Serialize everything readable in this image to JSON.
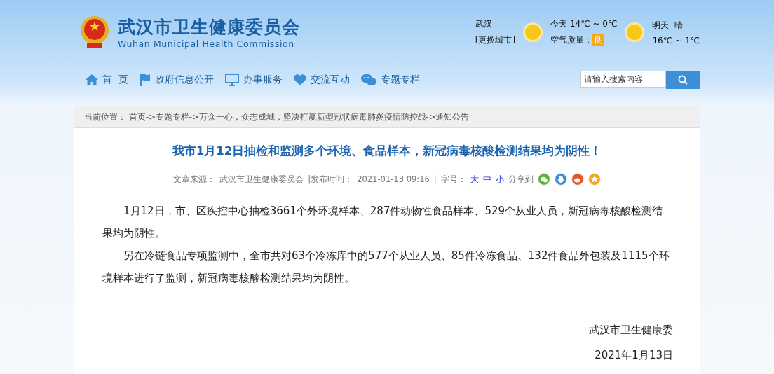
{
  "header": {
    "title": "武汉市卫生健康委员会",
    "subtitle": "Wuhan Municipal Health Commission"
  },
  "weather": {
    "city": "武汉",
    "change_city": "[更换城市]",
    "today": "今天 14℃ ~ 0℃",
    "air_label": "空气质量：",
    "air_value": "良",
    "tomorrow": "明天  晴",
    "tomorrow_temp": "16℃ ~ 1℃"
  },
  "nav": [
    {
      "label": "首  页",
      "kind": "home"
    },
    {
      "label": "政府信息公开",
      "kind": "flag"
    },
    {
      "label": "办事服务",
      "kind": "monitor"
    },
    {
      "label": "交流互动",
      "kind": "heart"
    },
    {
      "label": "专题专栏",
      "kind": "chat"
    }
  ],
  "search": {
    "placeholder": "请输入搜索内容"
  },
  "breadcrumb": {
    "label": "当前位置：",
    "path": "首页->专题专栏->万众一心，众志成城，坚决打赢新型冠状病毒肺炎疫情防控战->通知公告"
  },
  "article": {
    "title": "我市1月12日抽检和监测多个环境、食品样本，新冠病毒核酸检测结果均为阴性！",
    "source_label": "文章来源：",
    "source": "武汉市卫生健康委员会",
    "date_label": "|发布时间：",
    "date": "2021-01-13 09:16",
    "sep": "|",
    "size_label": "字号：",
    "sizes": [
      "大",
      "中",
      "小"
    ],
    "share_label": "分享到",
    "share": [
      {
        "kind": "wechat",
        "color": "#5cb531"
      },
      {
        "kind": "qq",
        "color": "#3a8fd8"
      },
      {
        "kind": "weibo",
        "color": "#e8562a"
      },
      {
        "kind": "star",
        "color": "#f0a818"
      }
    ],
    "paragraphs": [
      "1月12日，市、区疾控中心抽检3661个外环境样本、287件动物性食品样本、529个从业人员，新冠病毒核酸检测结果均为阴性。",
      "另在冷链食品专项监测中，全市共对63个冷冻库中的577个从业人员、85件冷冻食品、132件食品外包装及1115个环境样本进行了监测，新冠病毒核酸检测结果均为阴性。"
    ],
    "signature": "武汉市卫生健康委",
    "sign_date": "2021年1月13日"
  }
}
